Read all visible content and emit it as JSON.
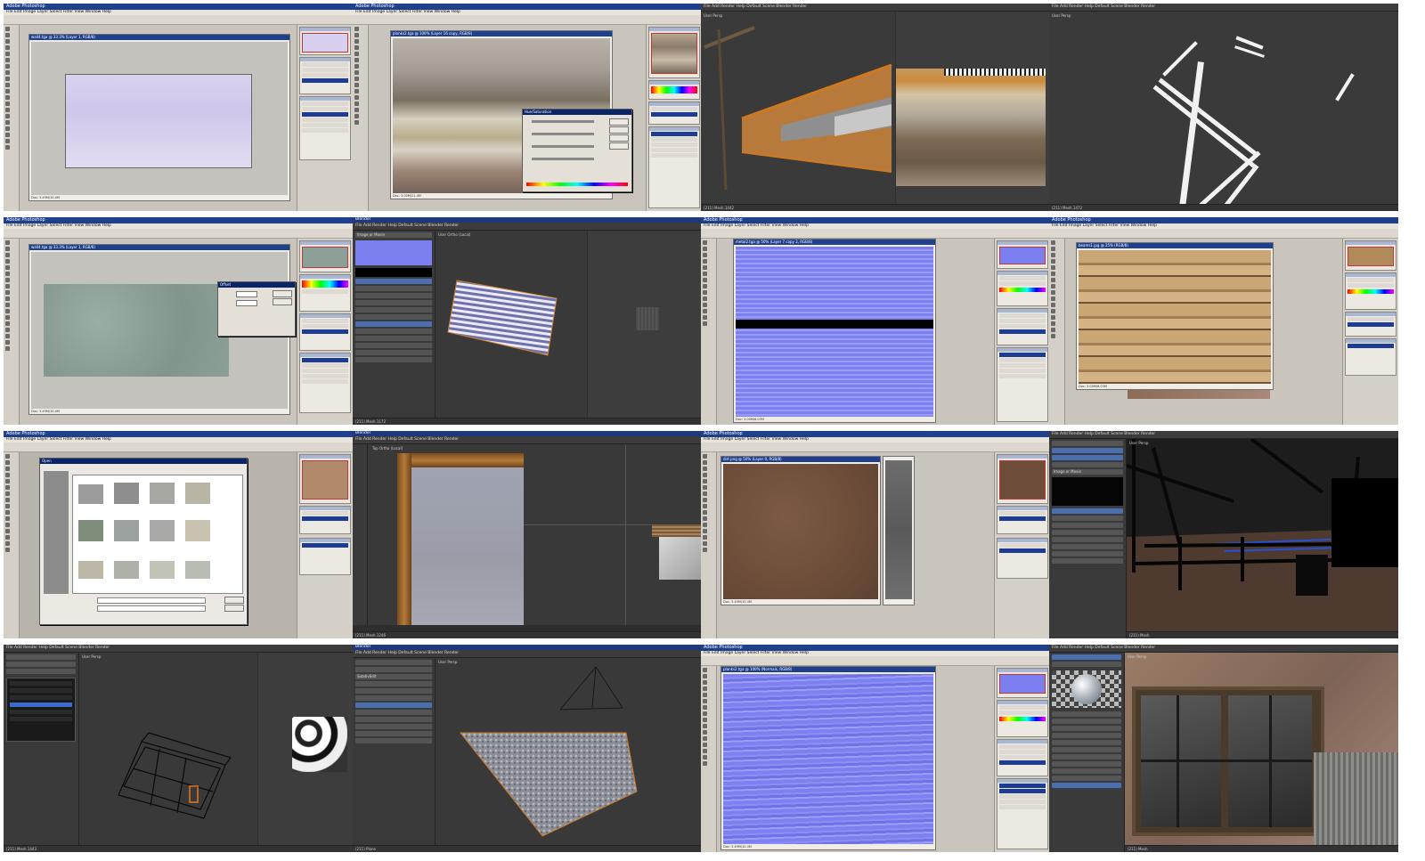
{
  "grid": {
    "tiles": [
      {
        "app": "Adobe Photoshop",
        "doc": "wall4.tga @ 33.3% (Layer 1, RGB/8)",
        "note": "",
        "status": "Doc: 3.49M/10.4M"
      },
      {
        "app": "Adobe Photoshop",
        "doc": "planks2.tga @ 100% (Layer 16 copy, RGB/8)",
        "note": "Hue/Saturation",
        "status": "Doc: 3.00M/21.4M"
      },
      {
        "app": "Blender",
        "doc": "User Persp",
        "note": "",
        "status": "(211) Mesh.1442"
      },
      {
        "app": "Blender",
        "doc": "User Persp",
        "note": "",
        "status": "(211) Mesh.1472"
      },
      {
        "app": "Adobe Photoshop",
        "doc": "wall4.tga @ 33.3% (Layer 1, RGB/8)",
        "note": "Offset",
        "status": "Doc: 3.49M/10.4M"
      },
      {
        "app": "Blender",
        "doc": "User Ortho (Local)",
        "note": "Image or Movie",
        "status": "(211) Mesh.1172"
      },
      {
        "app": "Adobe Photoshop",
        "doc": "metal2.tga @ 50% (Layer 7 copy 2, RGB/8)",
        "note": "",
        "status": "Doc: 3.00M/6.03M"
      },
      {
        "app": "Adobe Photoshop",
        "doc": "beams1.jpg @ 25% (RGB/8)",
        "note": "",
        "status": "Doc: 3.00M/6.03M"
      },
      {
        "app": "Adobe Photoshop",
        "doc": "",
        "note": "Open",
        "status": ""
      },
      {
        "app": "Blender",
        "doc": "Top Ortho (Local)",
        "note": "",
        "status": "(211) Mesh.1246"
      },
      {
        "app": "Adobe Photoshop",
        "doc": "dirt.png @ 50% (Layer 0, RGB/8)",
        "note": "",
        "status": "Doc: 3.49M/10.4M"
      },
      {
        "app": "Blender",
        "doc": "User Persp",
        "note": "Image or Movie",
        "status": "(211) Mesh"
      },
      {
        "app": "Blender",
        "doc": "User Persp",
        "note": "",
        "status": "(211) Mesh.1443"
      },
      {
        "app": "Blender",
        "doc": "User Persp",
        "note": "SubdivEdit",
        "status": "(211) Plane"
      },
      {
        "app": "Adobe Photoshop",
        "doc": "planks2.tga @ 100% (Normals, RGB/8)",
        "note": "",
        "status": "Doc: 3.49M/10.4M"
      },
      {
        "app": "Blender",
        "doc": "User Persp",
        "note": "",
        "status": "(211) Mesh"
      }
    ]
  },
  "ps_menu": "File  Edit  Image  Layer  Select  Filter  View  Window  Help",
  "bl_menu": "File  Add  Render  Help     Default     Scene     Blender Render",
  "colors": {
    "ps_title": "#1f3f8f",
    "normal_map": "#7b7ff0",
    "wood": "#b08a5a",
    "concrete": "#8fa39a",
    "dirt": "#6e4e3a"
  }
}
